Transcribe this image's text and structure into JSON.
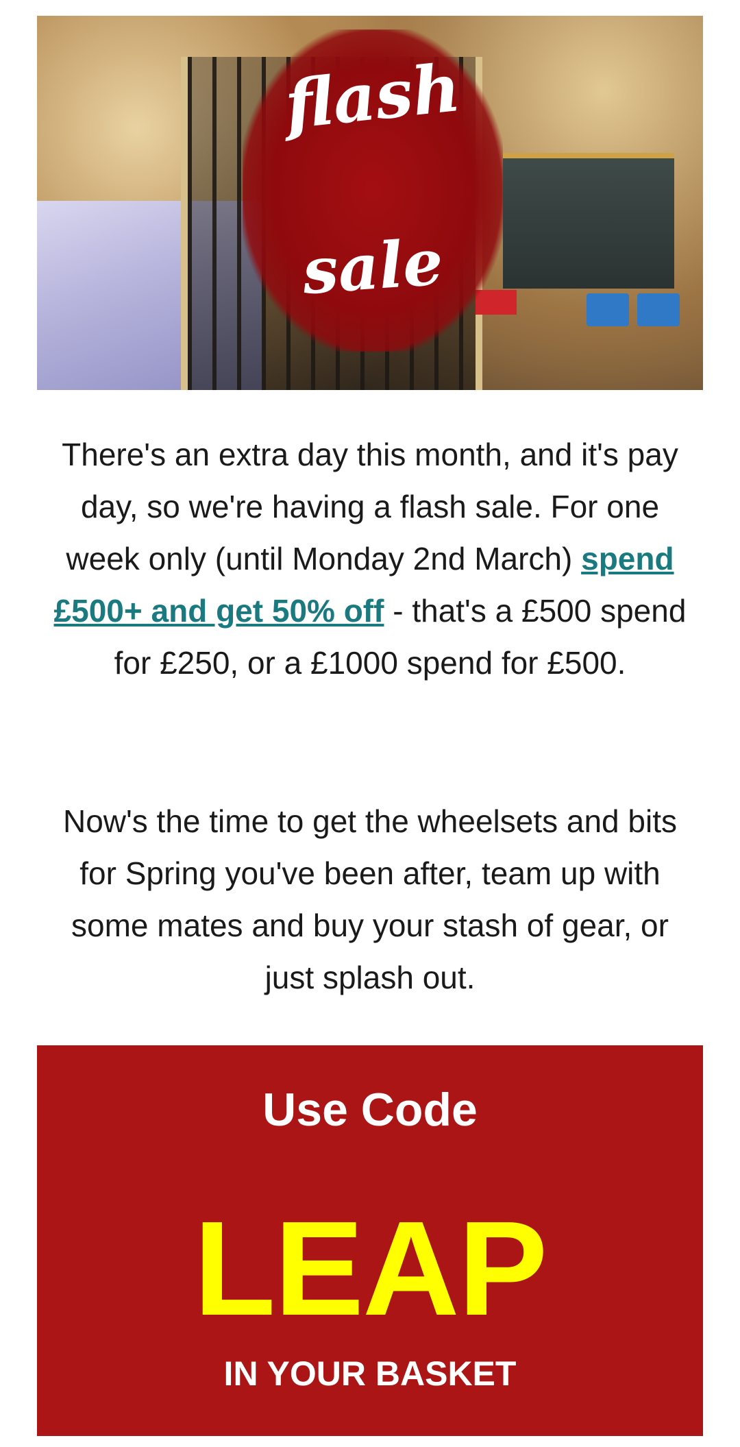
{
  "hero": {
    "flash_word": "flash",
    "sale_word": "sale"
  },
  "body": {
    "paragraph1_before_link": "There's an extra day this month, and it's pay day, so we're having a flash sale. For one week only (until Monday 2nd March) ",
    "paragraph1_link": "spend £500+ and get 50% off",
    "paragraph1_after_link": " - that's a £500 spend for £250, or a £1000 spend for £500.",
    "paragraph2": "Now's the time to get the wheelsets and bits for Spring you've been after, team up with some mates and buy your stash of gear, or just splash out."
  },
  "code_box": {
    "heading": "Use Code",
    "code": "LEAP",
    "footer": "IN YOUR BASKET",
    "background_color": "#ac1515",
    "code_color": "#ffff00"
  }
}
